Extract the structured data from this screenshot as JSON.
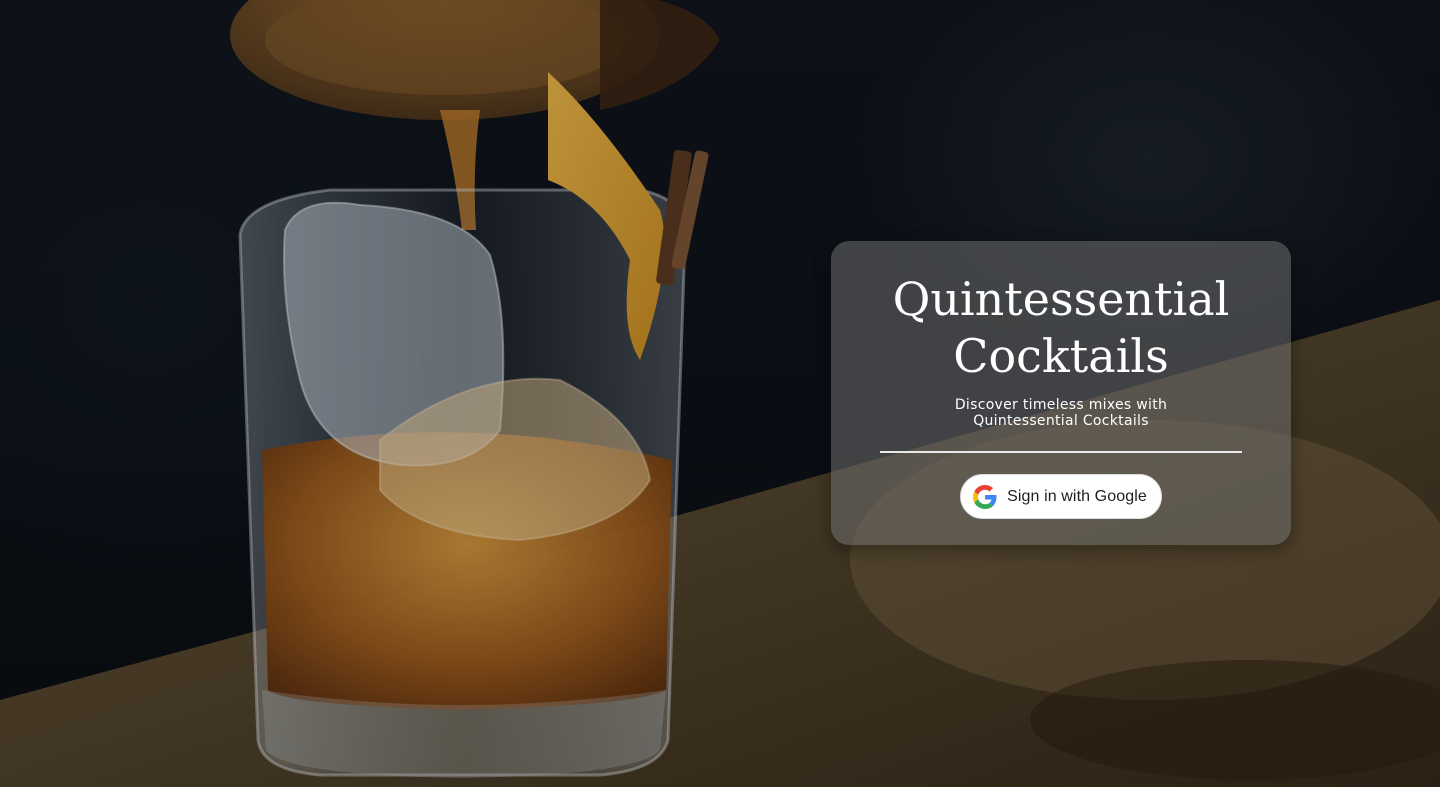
{
  "login_card": {
    "title": "Quintessential Cocktails",
    "subtitle": "Discover timeless mixes with Quintessential Cocktails",
    "signin_button_label": "Sign in with Google",
    "signin_icon": "google-g-icon"
  },
  "background": {
    "subject": "whiskey-cocktail-photo"
  },
  "colors": {
    "card_background": "#6e6e6e",
    "title_text": "#ffffff",
    "divider": "#e9e9e9",
    "button_background": "#ffffff",
    "button_text": "#1f1f1f",
    "google_blue": "#4285F4",
    "google_red": "#EA4335",
    "google_yellow": "#FBBC05",
    "google_green": "#34A853"
  }
}
